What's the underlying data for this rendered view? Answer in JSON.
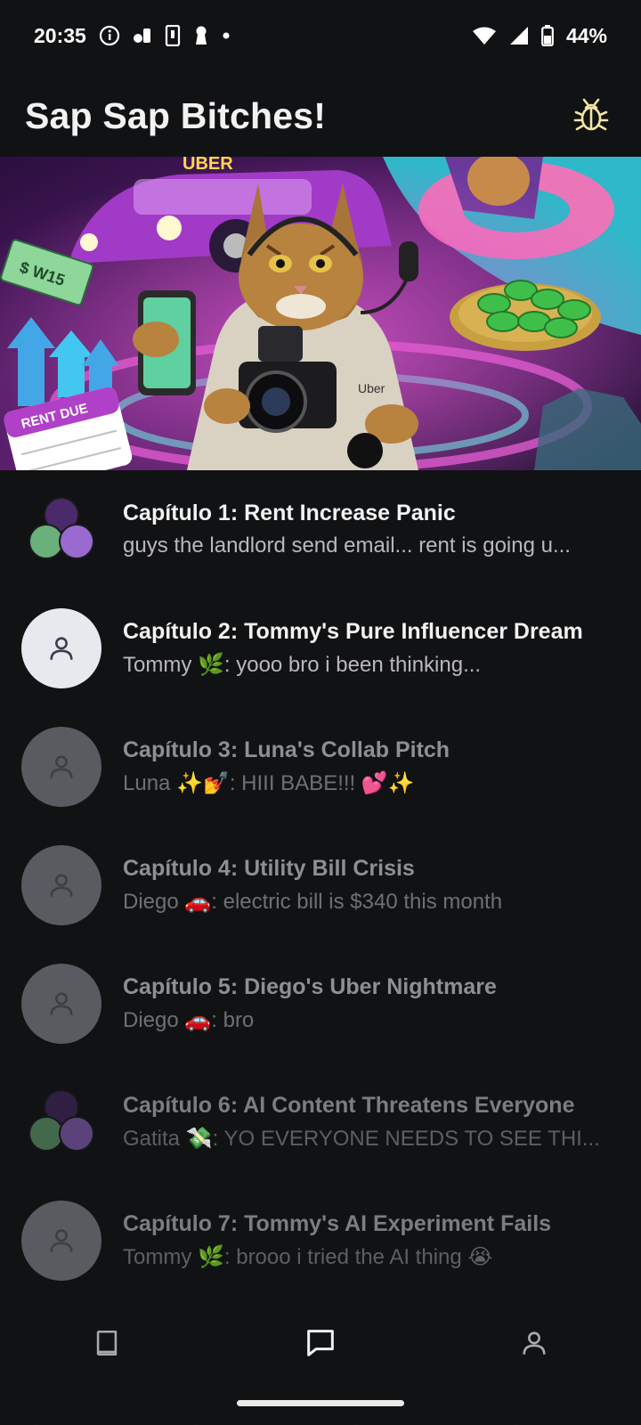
{
  "status_bar": {
    "time": "20:35",
    "battery": "44%"
  },
  "header": {
    "title": "Sap Sap Bitches!",
    "action_icon": "bug-icon"
  },
  "banner": {
    "image": "cat-uber-banner",
    "texts": {
      "rent_due": "RENT DUE",
      "uber_sign": "UBER",
      "shirt": "Uber",
      "money": "$ W15"
    }
  },
  "chats": [
    {
      "title": "Capítulo 1: Rent Increase Panic",
      "preview": "guys the landlord send email... rent is going u...",
      "avatar": "group"
    },
    {
      "title": "Capítulo 2: Tommy's Pure Influencer Dream",
      "preview": "Tommy 🌿: yooo bro i been thinking...",
      "avatar": "person-light"
    },
    {
      "title": "Capítulo 3: Luna's Collab Pitch",
      "preview": "Luna ✨💅: HIII BABE!!! 💕✨",
      "avatar": "person-dim"
    },
    {
      "title": "Capítulo 4: Utility Bill Crisis",
      "preview": "Diego 🚗: electric bill is $340 this month",
      "avatar": "person-dim"
    },
    {
      "title": "Capítulo 5: Diego's Uber Nightmare",
      "preview": "Diego 🚗: bro",
      "avatar": "person-dim"
    },
    {
      "title": "Capítulo 6: AI Content Threatens Everyone",
      "preview": "Gatita 💸: YO EVERYONE NEEDS TO SEE THI...",
      "avatar": "group"
    },
    {
      "title": "Capítulo 7: Tommy's AI Experiment Fails",
      "preview": "Tommy 🌿: brooo i tried the AI thing 😭",
      "avatar": "person-dim"
    }
  ],
  "bottom_nav": [
    {
      "name": "book-icon",
      "active": false
    },
    {
      "name": "chat-icon",
      "active": true
    },
    {
      "name": "profile-icon",
      "active": false
    }
  ],
  "colors": {
    "background": "#111214",
    "text_primary": "#f2f2f2",
    "text_secondary": "#b9b9bc",
    "avatar_light": "#e8e9ee",
    "avatar_dim": "#5a5b61",
    "bug_icon": "#f2e6a0"
  }
}
